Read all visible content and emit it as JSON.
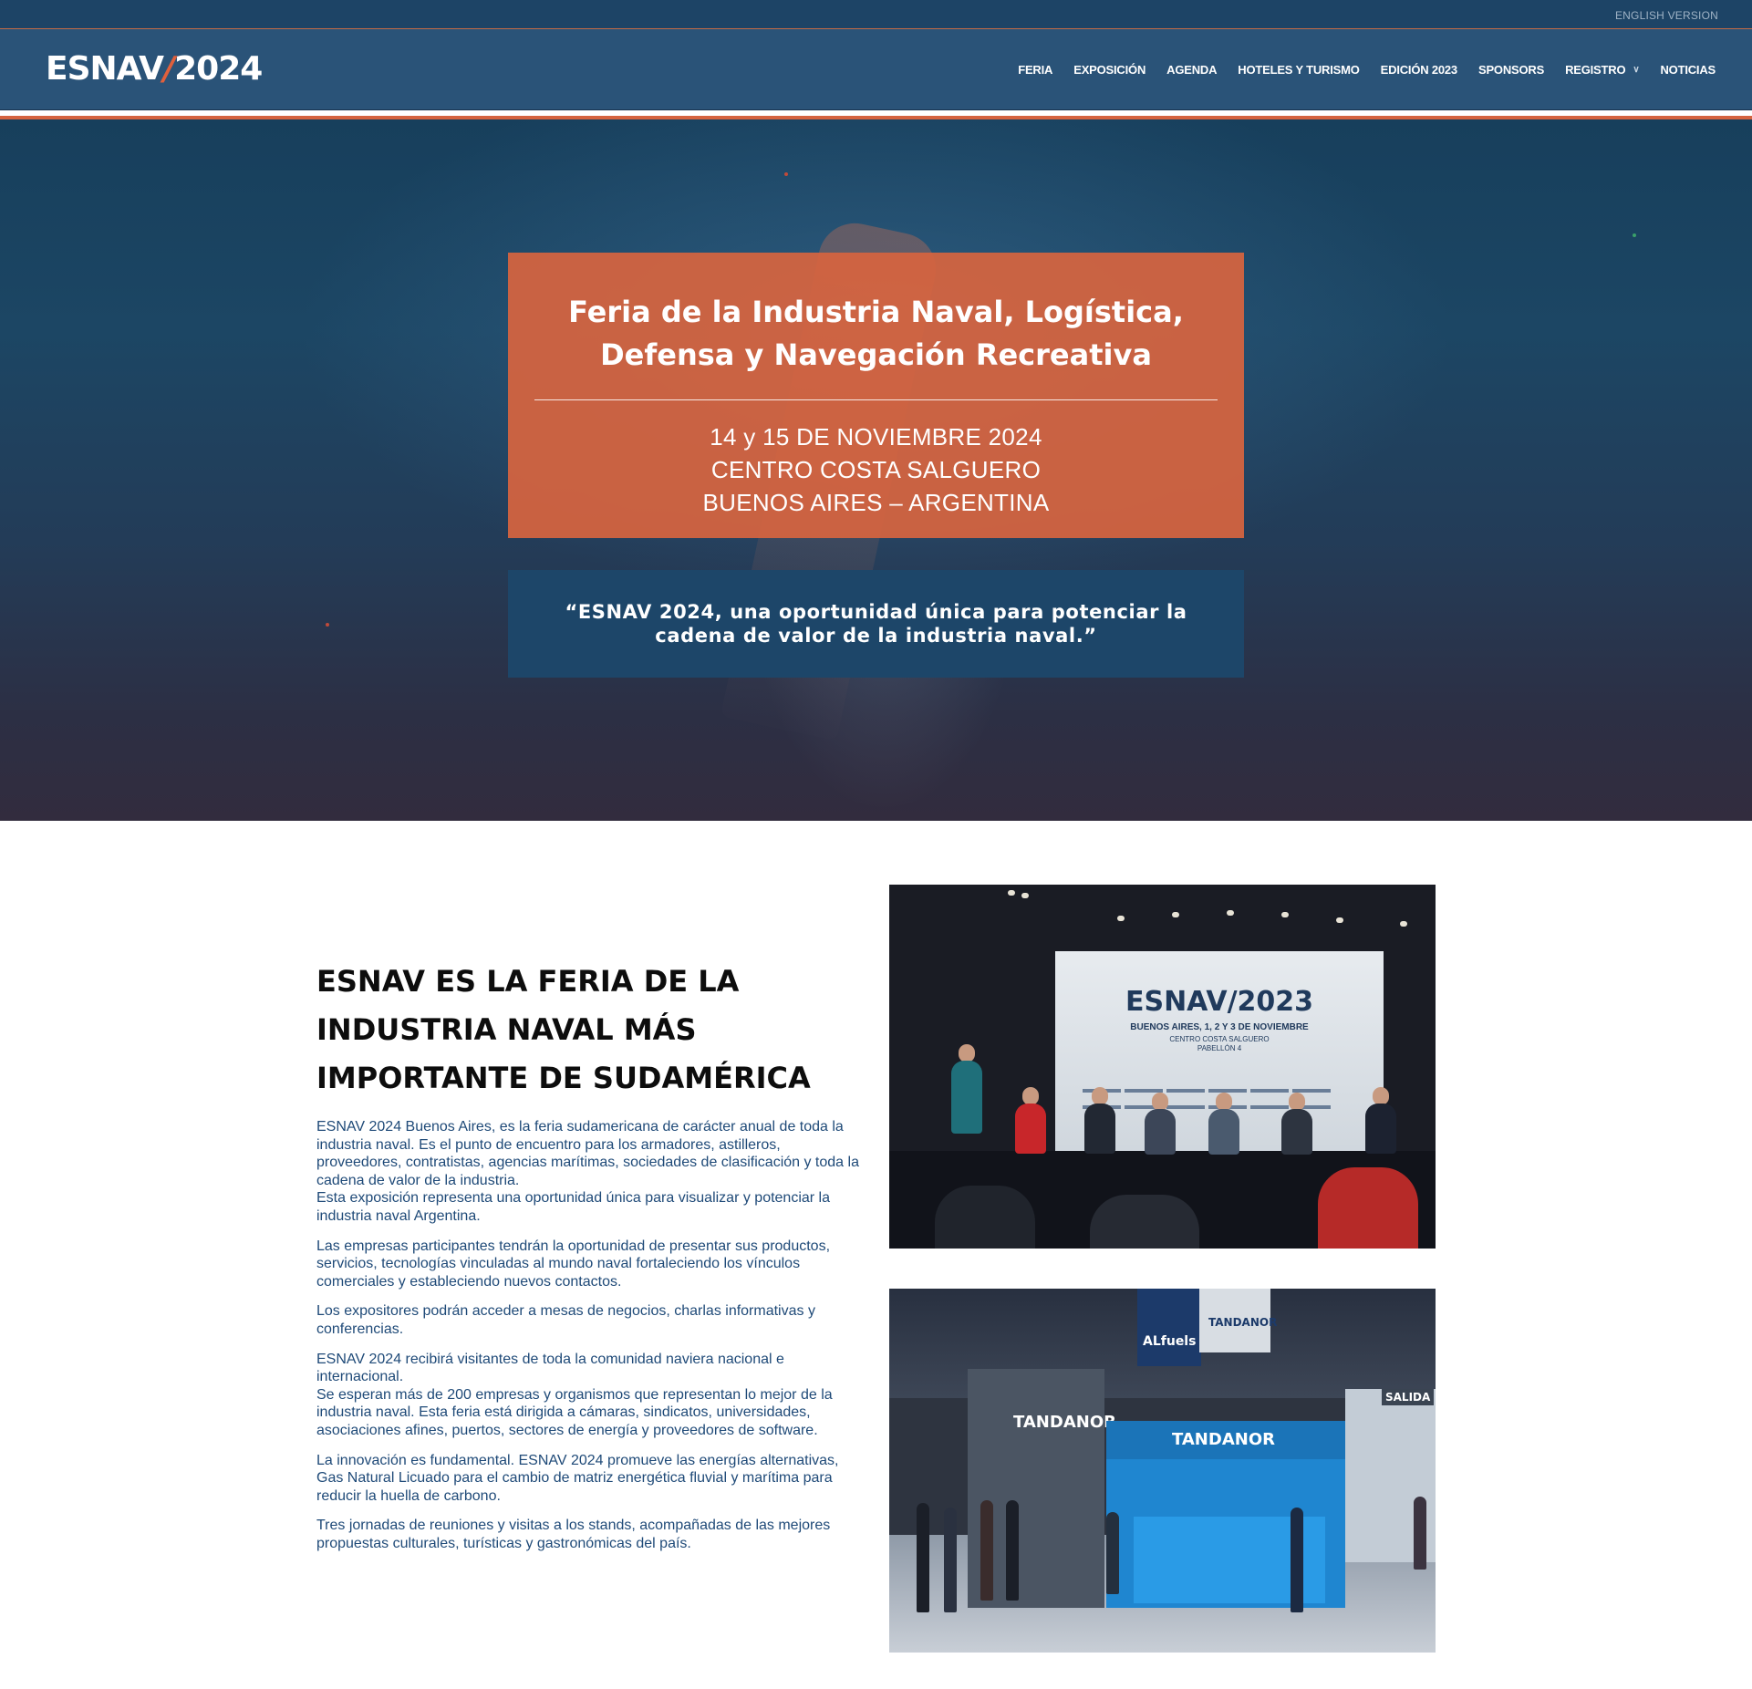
{
  "topbar": {
    "language_link": "ENGLISH VERSION"
  },
  "header": {
    "logo_main": "ESNAV",
    "logo_slash": "/",
    "logo_year": "2024",
    "nav": [
      "FERIA",
      "EXPOSICIÓN",
      "AGENDA",
      "HOTELES Y TURISMO",
      "EDICIÓN 2023",
      "SPONSORS",
      "REGISTRO",
      "NOTICIAS"
    ]
  },
  "hero": {
    "title": "Feria de la Industria Naval, Logística, Defensa y Navegación Recreativa",
    "date": "14 y 15 DE NOVIEMBRE 2024",
    "venue": "CENTRO COSTA SALGUERO",
    "location": "BUENOS AIRES – ARGENTINA",
    "quote": "“ESNAV 2024, una oportunidad única para potenciar la cadena de valor de la industria naval.”"
  },
  "about": {
    "heading": "ESNAV ES LA FERIA DE LA INDUSTRIA NAVAL MÁS IMPORTANTE DE SUDAMÉRICA",
    "paragraphs": [
      "ESNAV 2024 Buenos Aires, es la feria sudamericana de carácter anual de toda la industria naval. Es el punto de encuentro para los armadores, astilleros, proveedores, contratistas, agencias marítimas, sociedades de clasificación y toda la cadena de valor de la industria.",
      "Esta exposición representa una oportunidad única para visualizar y potenciar la industria naval Argentina.",
      "Las empresas participantes tendrán la oportunidad de presentar sus productos, servicios, tecnologías vinculadas al mundo naval fortaleciendo los vínculos comerciales y estableciendo nuevos contactos.",
      "Los expositores podrán acceder a mesas de negocios, charlas informativas y conferencias.",
      "ESNAV 2024 recibirá visitantes de toda la comunidad naviera nacional e internacional.",
      "Se esperan más de 200 empresas y organismos que representan lo mejor de la industria naval. Esta feria está dirigida a cámaras, sindicatos, universidades, asociaciones afines, puertos, sectores de energía y proveedores de software.",
      "La innovación es fundamental. ESNAV 2024 promueve las energías alternativas, Gas Natural Licuado para el cambio de matriz energética fluvial y marítima para reducir la huella de carbono.",
      "Tres jornadas de reuniones y visitas a los stands, acompañadas de las mejores propuestas culturales, turísticas y gastronómicas del país."
    ]
  },
  "photo1": {
    "screen_brand": "ESNAV/2023",
    "screen_sub": "BUENOS AIRES, 1, 2 Y 3 DE NOVIEMBRE",
    "screen_venue": "CENTRO COSTA SALGUERO",
    "screen_hall": "PABELLÓN 4"
  },
  "photo2": {
    "booth_name_1": "TANDANOR",
    "booth_name_2": "TANDANOR",
    "banner_text": "ALfuels",
    "exit_sign": "SALIDA"
  },
  "colors": {
    "topbar": "#1d4466",
    "header": "#2a5378",
    "accent": "#d5633f",
    "quote_box": "#1d4669",
    "body_text": "#1f4a78"
  }
}
